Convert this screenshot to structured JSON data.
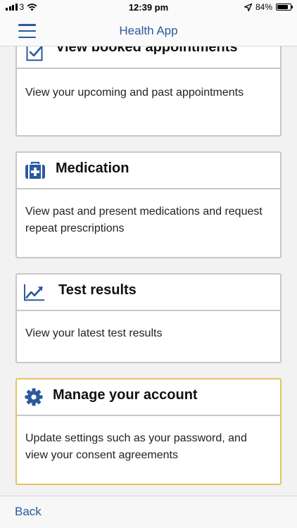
{
  "status_bar": {
    "carrier": "3",
    "time": "12:39 pm",
    "battery_percent": "84%",
    "battery_level": 0.84,
    "wifi_icon": "wifi-icon",
    "location_icon": "location-arrow-icon"
  },
  "nav": {
    "title": "Health App",
    "menu_icon": "hamburger-menu-icon"
  },
  "cards": [
    {
      "icon": "checkbox-icon",
      "title": "View booked appointments",
      "description": "View your upcoming and past appointments"
    },
    {
      "icon": "medical-kit-icon",
      "title": "Medication",
      "description": "View past and present medications and request repeat prescriptions"
    },
    {
      "icon": "line-chart-icon",
      "title": "Test results",
      "description": "View your latest test results"
    },
    {
      "icon": "gear-icon",
      "title": "Manage your account",
      "description": "Update settings such as your password, and view your consent agreements"
    }
  ],
  "bottom_bar": {
    "back_label": "Back"
  },
  "colors": {
    "accent": "#2b5a9e",
    "card_border": "#c7c7c7",
    "highlight_border": "#e8c262"
  }
}
